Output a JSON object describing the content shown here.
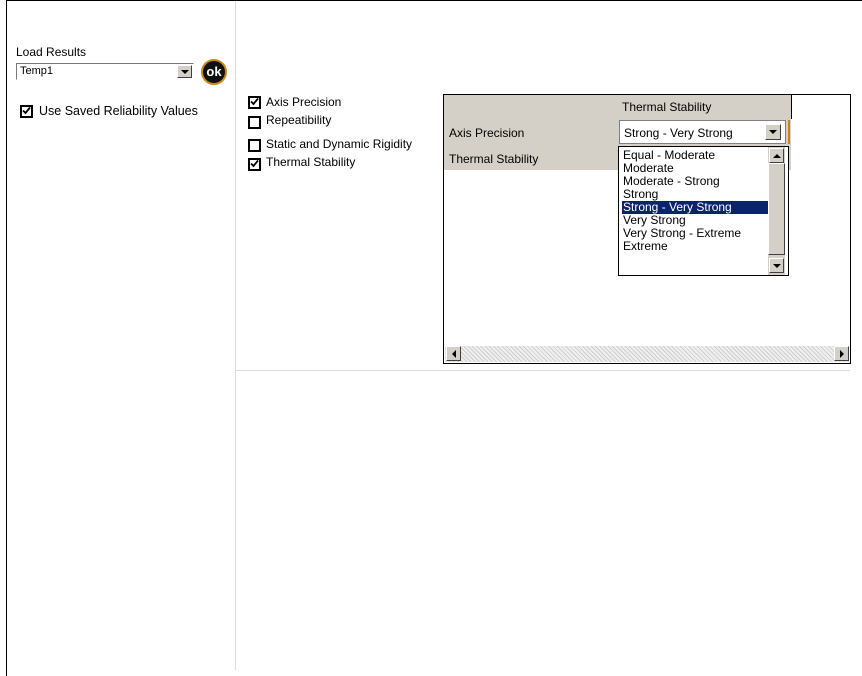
{
  "load_results": {
    "label": "Load Results",
    "selected": "Temp1",
    "ok_label": "ok"
  },
  "use_saved": {
    "label": "Use Saved Reliability Values",
    "checked": true
  },
  "criteria": [
    {
      "label": "Axis Precision",
      "checked": true
    },
    {
      "label": "Repeatibility",
      "checked": false
    },
    {
      "label": "Static and Dynamic Rigidity",
      "checked": false
    },
    {
      "label": "Thermal Stability",
      "checked": true
    }
  ],
  "grid": {
    "column_header": "Thermal Stability",
    "row_labels": [
      "Axis Precision",
      "Thermal Stability"
    ],
    "cell_value": "Strong - Very Strong"
  },
  "dropdown": {
    "options": [
      "Equal - Moderate",
      "Moderate",
      "Moderate - Strong",
      "Strong",
      "Strong - Very Strong",
      "Very Strong",
      "Very Strong - Extreme",
      "Extreme"
    ],
    "selected_index": 4
  },
  "colors": {
    "selection": "#0a246a",
    "ok_ring": "#c98a1c",
    "accent_marker": "#d67c14",
    "grid_header": "#d4d0c8"
  }
}
